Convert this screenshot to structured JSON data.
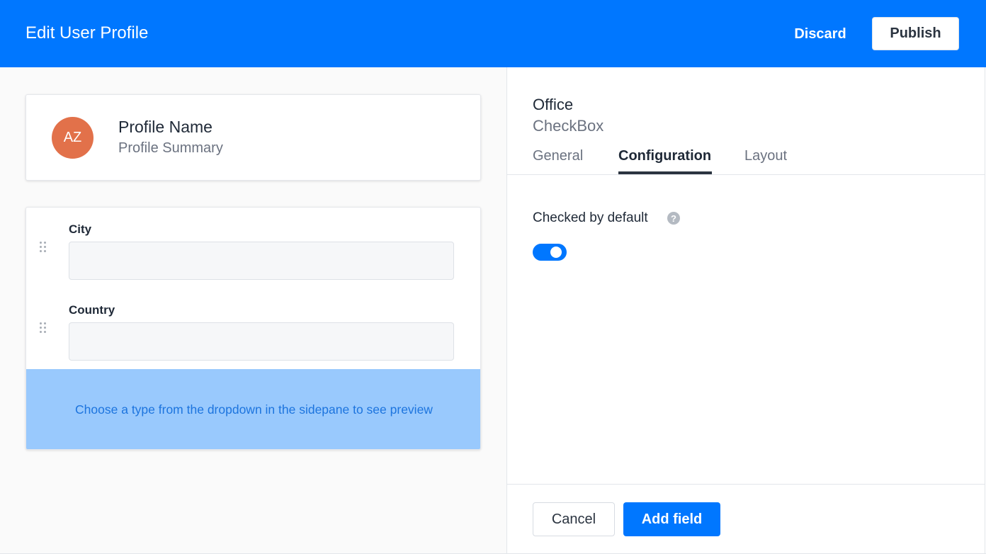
{
  "header": {
    "title": "Edit User Profile",
    "discard_label": "Discard",
    "publish_label": "Publish",
    "brand_color": "#0077ff"
  },
  "profile": {
    "avatar_initials": "AZ",
    "avatar_color": "#e2714a",
    "name": "Profile Name",
    "summary": "Profile Summary"
  },
  "form": {
    "fields": [
      {
        "label": "City",
        "value": ""
      },
      {
        "label": "Country",
        "value": ""
      }
    ],
    "preview_message": "Choose a type from the dropdown in the sidepane to see preview"
  },
  "sidepane": {
    "field_name": "Office",
    "field_type": "CheckBox",
    "tabs": [
      {
        "label": "General",
        "active": false
      },
      {
        "label": "Configuration",
        "active": true
      },
      {
        "label": "Layout",
        "active": false
      }
    ],
    "settings": {
      "checked_by_default_label": "Checked by default",
      "checked_by_default": true,
      "help_icon": "question-circle-icon",
      "help_glyph": "?"
    },
    "cancel_label": "Cancel",
    "add_field_label": "Add field"
  }
}
